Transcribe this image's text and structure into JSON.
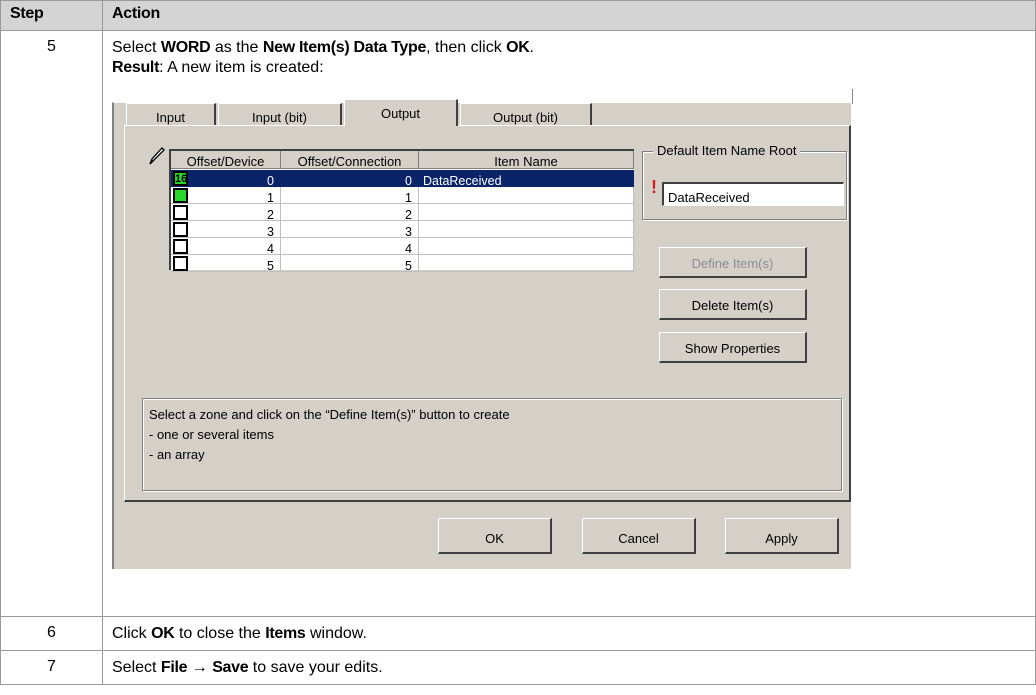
{
  "table": {
    "header": {
      "step": "Step",
      "action": "Action"
    },
    "rows": [
      {
        "step": "5",
        "line1": {
          "pre": "Select ",
          "b1": "WORD",
          "mid1": " as the ",
          "b2": "New Item(s) Data Type",
          "mid2": ", then click ",
          "b3": "OK",
          "post": "."
        },
        "line2": {
          "b1": "Result",
          "post": ": A new item is created:"
        }
      },
      {
        "step": "6",
        "line": {
          "pre": "Click ",
          "b1": "OK",
          "mid1": " to close the ",
          "b2": "Items",
          "post": " window."
        }
      },
      {
        "step": "7",
        "line": {
          "pre": "Select ",
          "b1": "File",
          "arrow": " → ",
          "b2": "Save",
          "post": " to save your edits."
        }
      }
    ]
  },
  "dialog": {
    "tabs": [
      {
        "label": "Input",
        "active": false
      },
      {
        "label": "Input (bit)",
        "active": false
      },
      {
        "label": "Output",
        "active": true
      },
      {
        "label": "Output (bit)",
        "active": false
      }
    ],
    "grid": {
      "columns": [
        "Offset/Device",
        "Offset/Connection",
        "Item Name"
      ],
      "rows": [
        {
          "device": "0",
          "connection": "0",
          "name": "DataReceived",
          "checked": true,
          "badge": "16",
          "selected": true
        },
        {
          "device": "1",
          "connection": "1",
          "name": "",
          "checked": true,
          "badge": "",
          "selected": false
        },
        {
          "device": "2",
          "connection": "2",
          "name": "",
          "checked": false,
          "badge": "",
          "selected": false
        },
        {
          "device": "3",
          "connection": "3",
          "name": "",
          "checked": false,
          "badge": "",
          "selected": false
        },
        {
          "device": "4",
          "connection": "4",
          "name": "",
          "checked": false,
          "badge": "",
          "selected": false
        },
        {
          "device": "5",
          "connection": "5",
          "name": "",
          "checked": false,
          "badge": "",
          "selected": false
        }
      ]
    },
    "group_title": "Default Item Name Root",
    "name_root_value": "DataReceived",
    "buttons": {
      "define": "Define Item(s)",
      "delete": "Delete Item(s)",
      "properties": "Show Properties",
      "ok": "OK",
      "cancel": "Cancel",
      "apply": "Apply"
    },
    "info": [
      "Select a zone and click on the “Define Item(s)” button to create",
      "- one or several items",
      "- an array"
    ],
    "colors": {
      "selection": "#0a246a",
      "badge_green": "#28d828",
      "warning_red": "#d81f1f",
      "face": "#d4d0c8"
    }
  }
}
